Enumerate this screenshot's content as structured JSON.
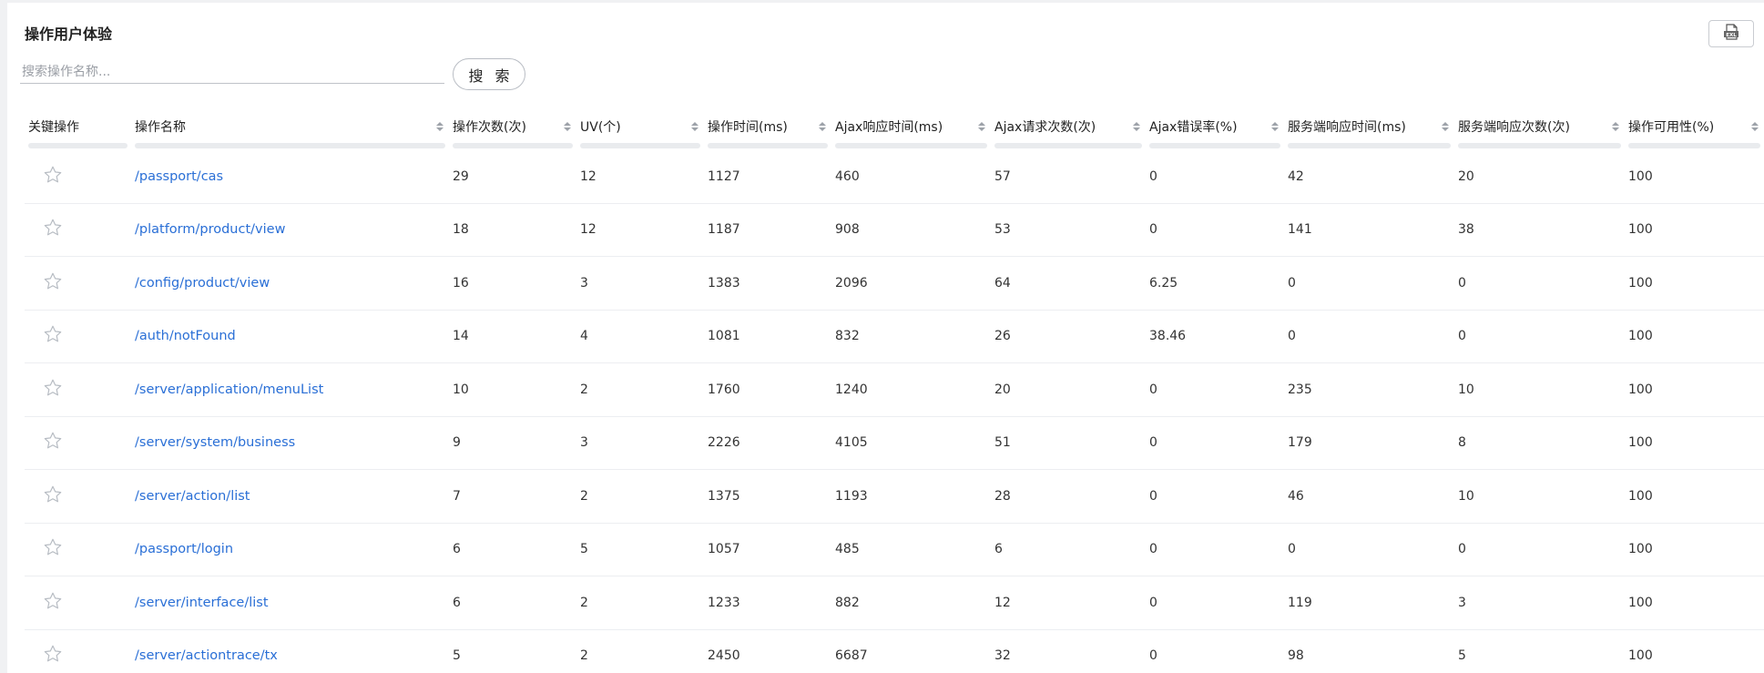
{
  "title": "操作用户体验",
  "export": {
    "label": "EXL",
    "icon": "excel-export-icon"
  },
  "search": {
    "placeholder": "搜索操作名称...",
    "value": "",
    "button_label": "搜 索"
  },
  "colors": {
    "link": "#2a6fd6",
    "star_outline": "#b7bcc3",
    "row_divider": "#eceef1"
  },
  "columns": [
    {
      "label": "关键操作",
      "sortable": false
    },
    {
      "label": "操作名称",
      "sortable": true
    },
    {
      "label": "操作次数(次)",
      "sortable": true
    },
    {
      "label": "UV(个)",
      "sortable": true
    },
    {
      "label": "操作时间(ms)",
      "sortable": true
    },
    {
      "label": "Ajax响应时间(ms)",
      "sortable": true
    },
    {
      "label": "Ajax请求次数(次)",
      "sortable": true
    },
    {
      "label": "Ajax错误率(%)",
      "sortable": true
    },
    {
      "label": "服务端响应时间(ms)",
      "sortable": true
    },
    {
      "label": "服务端响应次数(次)",
      "sortable": true
    },
    {
      "label": "操作可用性(%)",
      "sortable": true
    }
  ],
  "rows": [
    {
      "starred": false,
      "name": "/passport/cas",
      "count": "29",
      "uv": "12",
      "op_time": "1127",
      "ajax_time": "460",
      "ajax_count": "57",
      "ajax_err": "0",
      "srv_time": "42",
      "srv_count": "20",
      "availability": "100"
    },
    {
      "starred": false,
      "name": "/platform/product/view",
      "count": "18",
      "uv": "12",
      "op_time": "1187",
      "ajax_time": "908",
      "ajax_count": "53",
      "ajax_err": "0",
      "srv_time": "141",
      "srv_count": "38",
      "availability": "100"
    },
    {
      "starred": false,
      "name": "/config/product/view",
      "count": "16",
      "uv": "3",
      "op_time": "1383",
      "ajax_time": "2096",
      "ajax_count": "64",
      "ajax_err": "6.25",
      "srv_time": "0",
      "srv_count": "0",
      "availability": "100"
    },
    {
      "starred": false,
      "name": "/auth/notFound",
      "count": "14",
      "uv": "4",
      "op_time": "1081",
      "ajax_time": "832",
      "ajax_count": "26",
      "ajax_err": "38.46",
      "srv_time": "0",
      "srv_count": "0",
      "availability": "100"
    },
    {
      "starred": false,
      "name": "/server/application/menuList",
      "count": "10",
      "uv": "2",
      "op_time": "1760",
      "ajax_time": "1240",
      "ajax_count": "20",
      "ajax_err": "0",
      "srv_time": "235",
      "srv_count": "10",
      "availability": "100"
    },
    {
      "starred": false,
      "name": "/server/system/business",
      "count": "9",
      "uv": "3",
      "op_time": "2226",
      "ajax_time": "4105",
      "ajax_count": "51",
      "ajax_err": "0",
      "srv_time": "179",
      "srv_count": "8",
      "availability": "100"
    },
    {
      "starred": false,
      "name": "/server/action/list",
      "count": "7",
      "uv": "2",
      "op_time": "1375",
      "ajax_time": "1193",
      "ajax_count": "28",
      "ajax_err": "0",
      "srv_time": "46",
      "srv_count": "10",
      "availability": "100"
    },
    {
      "starred": false,
      "name": "/passport/login",
      "count": "6",
      "uv": "5",
      "op_time": "1057",
      "ajax_time": "485",
      "ajax_count": "6",
      "ajax_err": "0",
      "srv_time": "0",
      "srv_count": "0",
      "availability": "100"
    },
    {
      "starred": false,
      "name": "/server/interface/list",
      "count": "6",
      "uv": "2",
      "op_time": "1233",
      "ajax_time": "882",
      "ajax_count": "12",
      "ajax_err": "0",
      "srv_time": "119",
      "srv_count": "3",
      "availability": "100"
    },
    {
      "starred": false,
      "name": "/server/actiontrace/tx",
      "count": "5",
      "uv": "2",
      "op_time": "2450",
      "ajax_time": "6687",
      "ajax_count": "32",
      "ajax_err": "0",
      "srv_time": "98",
      "srv_count": "5",
      "availability": "100"
    }
  ]
}
